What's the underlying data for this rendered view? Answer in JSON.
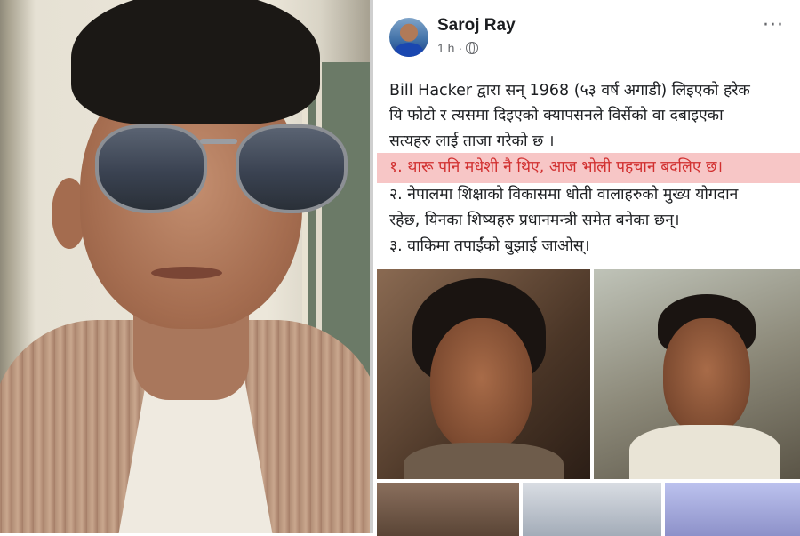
{
  "post": {
    "author": "Saroj Ray",
    "time": "1 h",
    "menu_icon": "more-horizontal-icon",
    "privacy_icon": "globe-icon",
    "lines": [
      "Bill Hacker द्वारा सन् 1968 (५३ वर्ष अगाडी) लिइएको हरेक",
      "यि फोटो र त्यसमा दिइएको क्यापसनले विर्सेको वा दबाइएका",
      "सत्यहरु लाई ताजा गरेको छ ।",
      "१. थारू पनि मधेशी नै थिए, आज भोली पहचान बदलिए छ।",
      "२. नेपालमा शिक्षाको विकासमा धोती वालाहरुको मुख्य योगदान",
      "रहेछ, यिनका शिष्यहरु प्रधानमन्त्री समेत बनेका छन्।",
      "३. वाकिमा तपाईंको बुझाई जाओस्।"
    ],
    "highlight_color": "#f7c6c6",
    "highlight_text_color": "#d12f2f"
  }
}
